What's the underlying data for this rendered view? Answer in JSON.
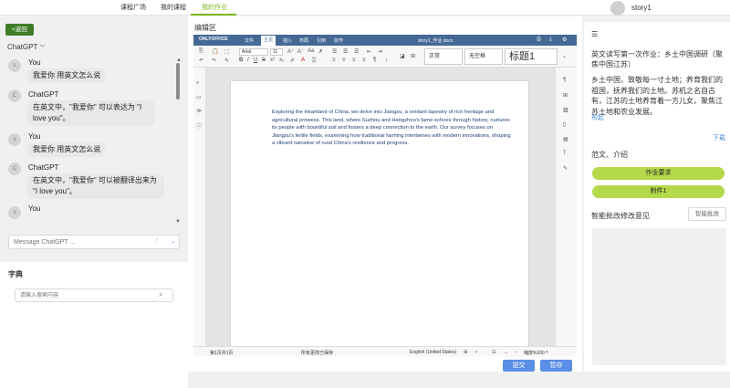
{
  "nav": {
    "tabs": [
      {
        "label": "课程广场"
      },
      {
        "label": "我的课程"
      },
      {
        "label": "我的作业"
      }
    ],
    "username": "story1"
  },
  "left": {
    "back_label": "<返回",
    "model_label": "ChatGPT",
    "messages": [
      {
        "avatar": "s",
        "sender": "You",
        "text": "我爱你 用英文怎么说"
      },
      {
        "avatar": "C",
        "sender": "ChatGPT",
        "text": "在英文中，\"我爱你\" 可以表达为 \"I love you\"。"
      },
      {
        "avatar": "s",
        "sender": "You",
        "text": "我爱你 用英文怎么说"
      },
      {
        "avatar": "C",
        "sender": "ChatGPT",
        "text": "在英文中，\"我爱你\" 可以被翻译出来为 \"I love you\"。"
      },
      {
        "avatar": "s",
        "sender": "You",
        "text": ""
      }
    ],
    "message_placeholder": "Message ChatGPT ...",
    "dict_title": "字典",
    "dict_placeholder": "请输入搜索内容"
  },
  "editor": {
    "section_label": "编辑区",
    "app_name": "ONLYOFFICE",
    "menus": [
      "文件",
      "主页",
      "插入",
      "布局",
      "引用",
      "协作"
    ],
    "doc_title": "story1_作业.docx",
    "font_name": "Arial",
    "font_size": "11",
    "styles": [
      "正常",
      "无空格",
      "标题1"
    ],
    "document_text": "Exploring the Heartland of China, we delve into Jiangsu, a verdant tapestry of rich heritage and agricultural prowess. This land, where Suzhou and Hangzhou's fame echoes through history, nurtures its people with bountiful soil and fosters a deep connection to the earth. Our survey focuses on Jiangsu's fertile fields, examining how traditional farming intertwines with modern innovations, shaping a vibrant narrative of rural China's resilience and progress.",
    "status": {
      "page": "第1页共1页",
      "saved": "所有更改已保存",
      "language": "English (United States)",
      "zoom": "缩放%100"
    },
    "submit_label": "提交",
    "save_label": "暂存"
  },
  "right": {
    "assignment_title": "英文读写第一次作业：乡土中国调研（聚焦中国江苏）",
    "assignment_body": "乡土中国，致敬每一寸土地；养育我们的祖国，抚养我们的土地。苏机之名自古有，江苏的土地养育着一方儿女，聚焦江苏土地和农业发展。",
    "more_label": "布起",
    "download_label": "下载",
    "examples_title": "范文、介绍",
    "buttons": [
      "作业要求",
      "附件1"
    ],
    "feedback_title": "智能批改修改意见",
    "feedback_button": "智能批改"
  },
  "colors": {
    "accent": "#7fb61d",
    "back_button": "#3f7d28",
    "onlyoffice_header": "#446995",
    "primary_button": "#5b8ee6",
    "green_button": "#b4d94a"
  }
}
